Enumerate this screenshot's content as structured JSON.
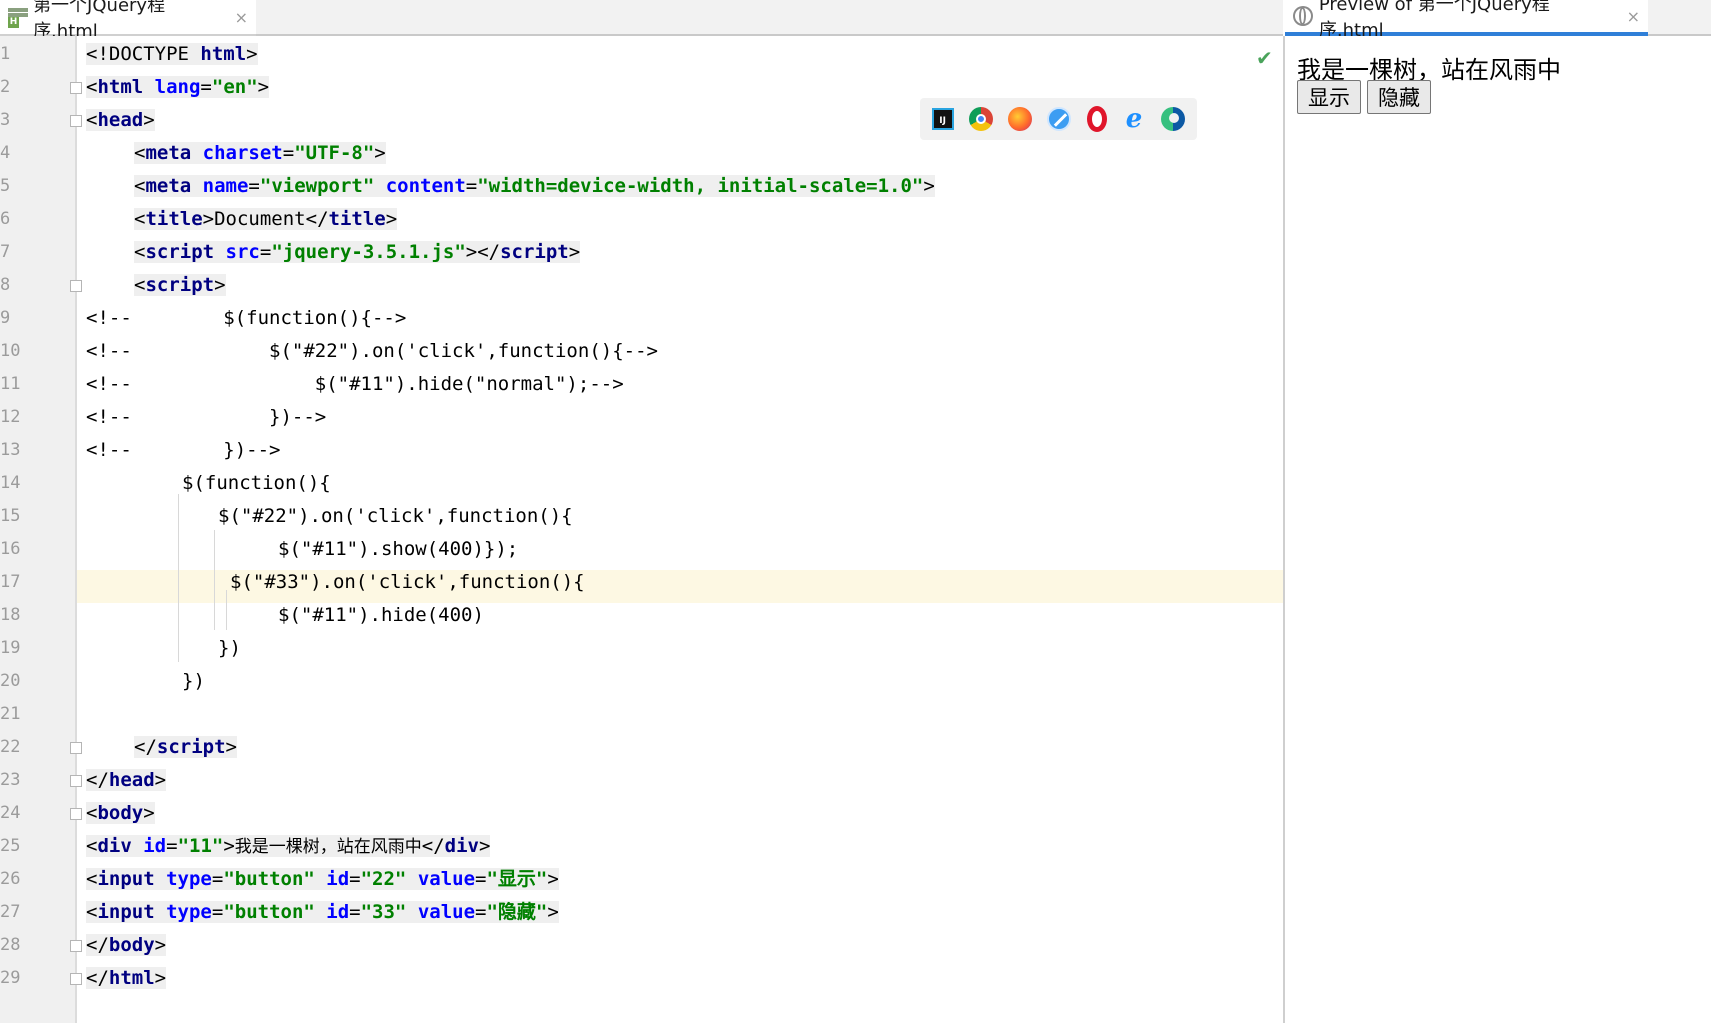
{
  "editor_tab": {
    "title": "第一个JQuery程序.html",
    "close": "×"
  },
  "preview_tab": {
    "title": "Preview of 第一个JQuery程序.html",
    "close": "×"
  },
  "browser_icons": [
    "intellij-icon",
    "chrome-icon",
    "firefox-icon",
    "safari-icon",
    "opera-icon",
    "ie-icon",
    "edge-icon"
  ],
  "status_check": "✔",
  "line_numbers": [
    "1",
    "2",
    "3",
    "4",
    "5",
    "6",
    "7",
    "8",
    "9",
    "10",
    "11",
    "12",
    "13",
    "14",
    "15",
    "16",
    "17",
    "18",
    "19",
    "20",
    "21",
    "22",
    "23",
    "24",
    "25",
    "26",
    "27",
    "28",
    "29"
  ],
  "code": {
    "l1_a": "<!DOCTYPE ",
    "l1_b": "html",
    "l1_c": ">",
    "l2_a": "<",
    "l2_tag": "html",
    "l2_attr": " lang",
    "l2_eq": "=",
    "l2_str": "\"en\"",
    "l2_end": ">",
    "l3_a": "<",
    "l3_tag": "head",
    "l3_end": ">",
    "l4_a": "<",
    "l4_tag": "meta",
    "l4_attr": " charset",
    "l4_eq": "=",
    "l4_str": "\"UTF-8\"",
    "l4_end": ">",
    "l5_a": "<",
    "l5_tag": "meta",
    "l5_attr1": " name",
    "l5_eq1": "=",
    "l5_str1": "\"viewport\"",
    "l5_attr2": " content",
    "l5_eq2": "=",
    "l5_str2": "\"width=device-width, initial-scale=1.0\"",
    "l5_end": ">",
    "l6_a": "<",
    "l6_tag": "title",
    "l6_b": ">",
    "l6_text": "Document",
    "l6_c": "</",
    "l6_tag2": "title",
    "l6_end": ">",
    "l7_a": "<",
    "l7_tag": "script",
    "l7_attr": " src",
    "l7_eq": "=",
    "l7_str": "\"jquery-3.5.1.js\"",
    "l7_b": "></",
    "l7_tag2": "script",
    "l7_end": ">",
    "l8_a": "<",
    "l8_tag": "script",
    "l8_end": ">",
    "l9": "<!--        $(function(){-->",
    "l10": "<!--            $(\"#22\").on('click',function(){-->",
    "l11": "<!--                $(\"#11\").hide(\"normal\");-->",
    "l12": "<!--            })-->",
    "l13": "<!--        })-->",
    "l14": "$(function(){",
    "l15": "$(\"#22\").on('click',function(){",
    "l16": "$(\"#11\").show(400)});",
    "l17": "$(\"#33\").on('click',function(){",
    "l18": "$(\"#11\").hide(400)",
    "l19": "})",
    "l20": "})",
    "l22_a": "</",
    "l22_tag": "script",
    "l22_end": ">",
    "l23_a": "</",
    "l23_tag": "head",
    "l23_end": ">",
    "l24_a": "<",
    "l24_tag": "body",
    "l24_end": ">",
    "l25_a": "<",
    "l25_tag": "div",
    "l25_attr": " id",
    "l25_eq": "=",
    "l25_str": "\"11\"",
    "l25_b": ">",
    "l25_text": "我是一棵树，站在风雨中",
    "l25_c": "</",
    "l25_tag2": "div",
    "l25_end": ">",
    "l26_a": "<",
    "l26_tag": "input",
    "l26_attr1": " type",
    "l26_eq1": "=",
    "l26_str1": "\"button\"",
    "l26_attr2": " id",
    "l26_eq2": "=",
    "l26_str2": "\"22\"",
    "l26_attr3": " value",
    "l26_eq3": "=",
    "l26_str3": "\"显示\"",
    "l26_end": ">",
    "l27_a": "<",
    "l27_tag": "input",
    "l27_attr1": " type",
    "l27_eq1": "=",
    "l27_str1": "\"button\"",
    "l27_attr2": " id",
    "l27_eq2": "=",
    "l27_str2": "\"33\"",
    "l27_attr3": " value",
    "l27_eq3": "=",
    "l27_str3": "\"隐藏\"",
    "l27_end": ">",
    "l28_a": "</",
    "l28_tag": "body",
    "l28_end": ">",
    "l29_a": "</",
    "l29_tag": "html",
    "l29_end": ">"
  },
  "preview": {
    "text": "我是一棵树，站在风雨中",
    "show_button": "显示",
    "hide_button": "隐藏"
  },
  "colors": {
    "tag": "#000080",
    "attr": "#0000ff",
    "string": "#008000",
    "current_line": "#fdf8e3",
    "preview_tab_accent": "#2f7fd8"
  }
}
